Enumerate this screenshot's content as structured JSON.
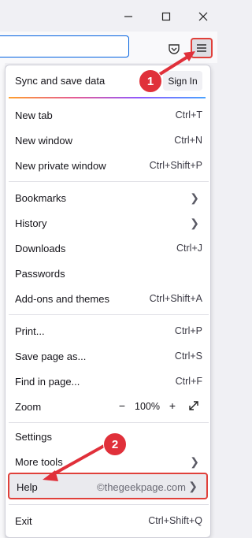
{
  "menu": {
    "sync_label": "Sync and save data",
    "signin_label": "Sign In",
    "items": [
      {
        "label": "New tab",
        "shortcut": "Ctrl+T"
      },
      {
        "label": "New window",
        "shortcut": "Ctrl+N"
      },
      {
        "label": "New private window",
        "shortcut": "Ctrl+Shift+P"
      },
      {
        "label": "Bookmarks",
        "shortcut": ""
      },
      {
        "label": "History",
        "shortcut": ""
      },
      {
        "label": "Downloads",
        "shortcut": "Ctrl+J"
      },
      {
        "label": "Passwords",
        "shortcut": ""
      },
      {
        "label": "Add-ons and themes",
        "shortcut": "Ctrl+Shift+A"
      },
      {
        "label": "Print...",
        "shortcut": "Ctrl+P"
      },
      {
        "label": "Save page as...",
        "shortcut": "Ctrl+S"
      },
      {
        "label": "Find in page...",
        "shortcut": "Ctrl+F"
      },
      {
        "label": "Zoom",
        "shortcut": ""
      },
      {
        "label": "Settings",
        "shortcut": ""
      },
      {
        "label": "More tools",
        "shortcut": ""
      },
      {
        "label": "Help",
        "shortcut": ""
      },
      {
        "label": "Exit",
        "shortcut": "Ctrl+Shift+Q"
      }
    ],
    "zoom": {
      "minus": "−",
      "value": "100%",
      "plus": "+"
    }
  },
  "annotations": {
    "step1": "1",
    "step2": "2",
    "watermark": "©thegeekpage.com",
    "color": "#e0303a"
  },
  "icons": [
    "minimize-icon",
    "maximize-icon",
    "pocket-icon",
    "hamburger-menu-icon",
    "chevron-right-icon",
    "fullscreen-icon"
  ]
}
